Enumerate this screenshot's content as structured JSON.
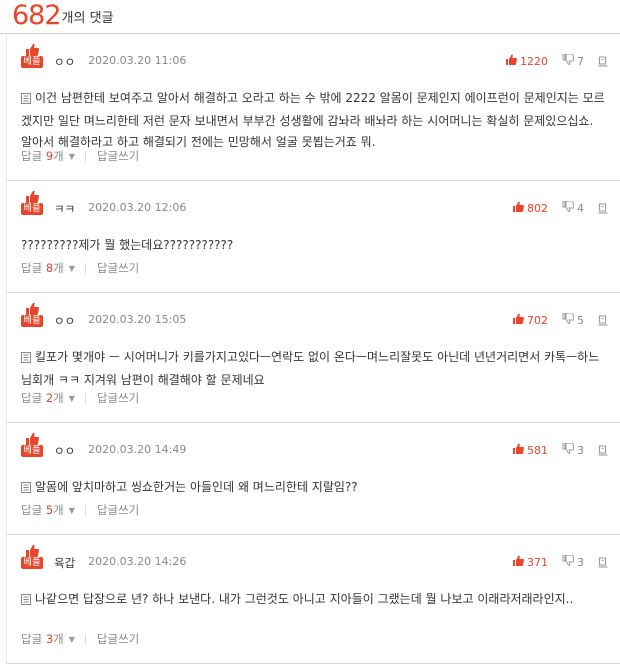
{
  "header": {
    "count": "682",
    "count_label": "개의 댓글"
  },
  "best_label": "베플",
  "reply_suffix": "개",
  "reply_prefix": "답글",
  "write_reply": "답글쓰기",
  "comments": [
    {
      "nickname": "ㅇㅇ",
      "date": "2020.03.20 11:06",
      "up": "1220",
      "down": "7",
      "has_doc_icon": true,
      "text": "이건 남편한테 보여주고 알아서 해결하고 오라고 하는 수 밖에 2222 알몸이 문제인지 에이프런이 문제인지는 모르겠지만 일단 며느리한테 저런 문자 보내면서 부부간 성생활에 감놔라 배놔라 하는 시어머니는 확실히 문제있으십쇼. 알아서 해결하라고 하고 해결되기 전에는 민망해서 얼굴 못뵙는거죠 뭐.",
      "replies": "9"
    },
    {
      "nickname": "ㅋㅋ",
      "date": "2020.03.20 12:06",
      "up": "802",
      "down": "4",
      "has_doc_icon": false,
      "text": "?????????제가 뭘 했는데요???????????",
      "replies": "8"
    },
    {
      "nickname": "ㅇㅇ",
      "date": "2020.03.20 15:05",
      "up": "702",
      "down": "5",
      "has_doc_icon": true,
      "text": "킬포가 몇개야 ㅡ 시어머니가 키를가지고있다ㅡ연락도 없이 온다ㅡ며느리잘못도 아닌데 년년거리면서 카톡ㅡ하느님회개 ㅋㅋ 지겨워 남편이 해결해야 할 문제네요",
      "replies": "2"
    },
    {
      "nickname": "ㅇㅇ",
      "date": "2020.03.20 14:49",
      "up": "581",
      "down": "3",
      "has_doc_icon": true,
      "text": "알몸에 앞치마하고 씽쇼한거는 아들인데 왜 며느리한테 지랄임??",
      "replies": "5"
    },
    {
      "nickname": "육갑",
      "date": "2020.03.20 14:26",
      "up": "371",
      "down": "3",
      "has_doc_icon": true,
      "text": "나같으면 답장으로 년? 하나 보낸다. 내가 그런것도 아니고 지아들이 그랬는데 뭘 나보고 이래라저래라인지..",
      "replies": "3"
    }
  ],
  "colors": {
    "accent": "#e8452a",
    "muted": "#888888",
    "divider": "#d8d8d8"
  },
  "icons": {
    "best": "thumbs-up-icon",
    "up": "thumbs-up-icon",
    "down": "thumbs-down-icon",
    "report": "report-icon",
    "doc": "document-icon",
    "caret": "caret-down-icon"
  }
}
